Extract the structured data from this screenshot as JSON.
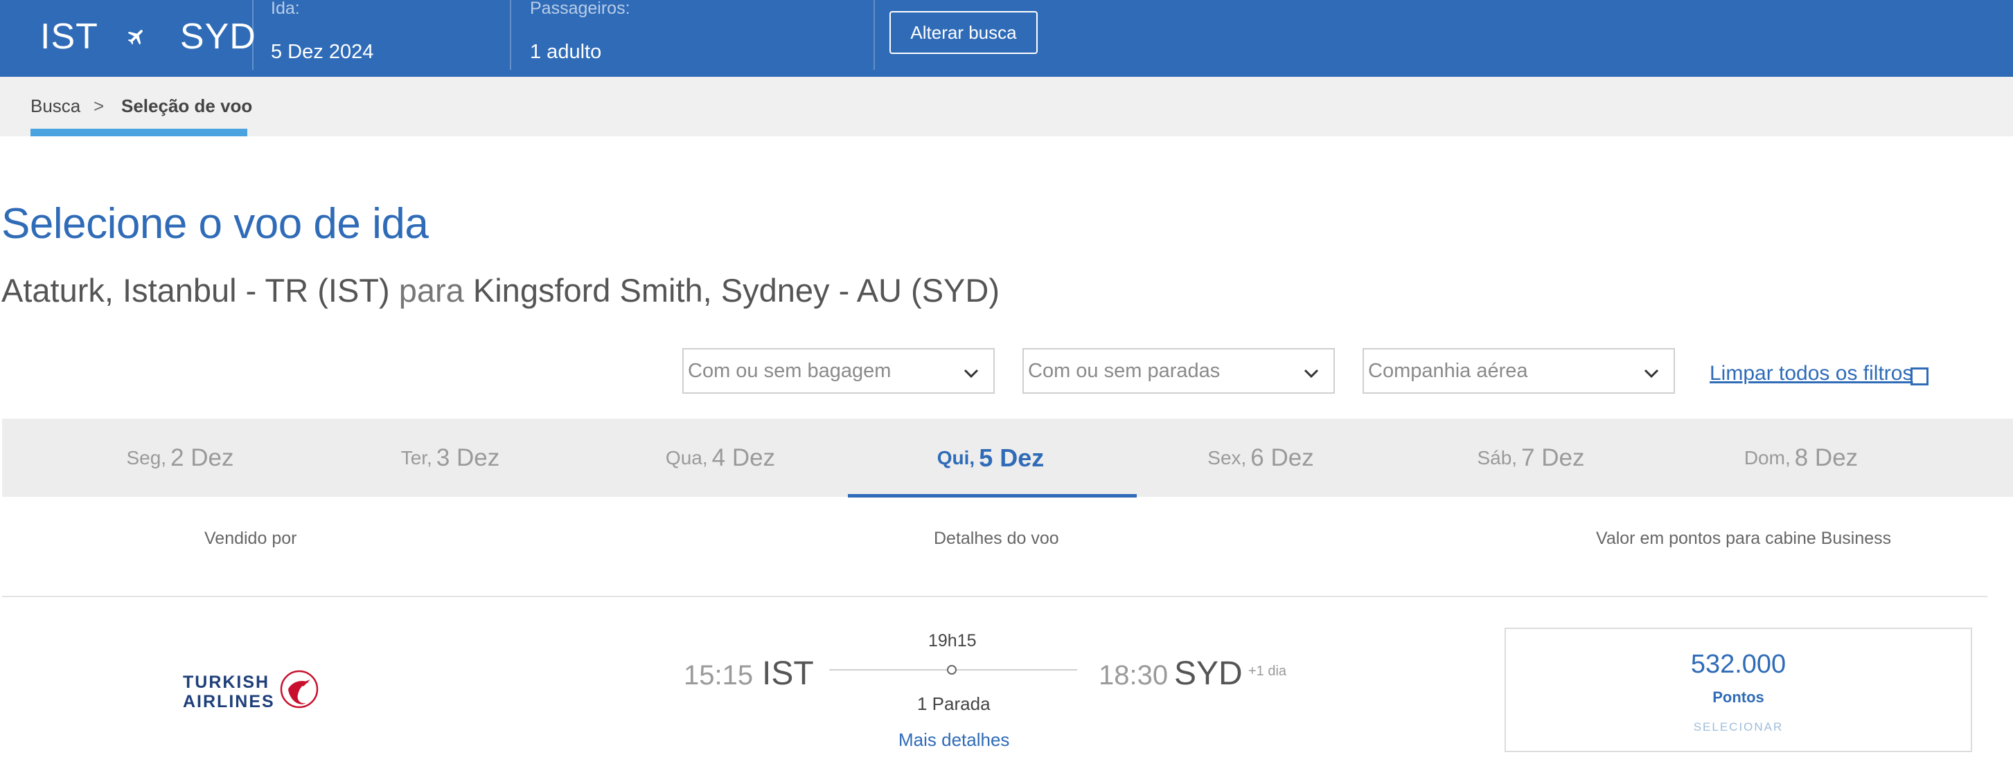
{
  "header": {
    "origin": "IST",
    "destination": "SYD",
    "plane_icon": "airplane-icon",
    "ida_label": "Ida:",
    "ida_value": "5 Dez 2024",
    "passengers_label": "Passageiros:",
    "passengers_value": "1 adulto",
    "change_search_label": "Alterar busca"
  },
  "breadcrumb": {
    "step1": "Busca",
    "separator": ">",
    "step2": "Seleção de voo"
  },
  "page": {
    "title": "Selecione o voo de ida",
    "subtitle_from": "Ataturk, Istanbul - TR (IST)",
    "subtitle_connector": "para",
    "subtitle_to": "Kingsford Smith, Sydney - AU (SYD)"
  },
  "filters": {
    "baggage_placeholder": "Com ou sem bagagem",
    "stops_placeholder": "Com ou sem paradas",
    "airline_placeholder": "Companhia aérea",
    "clear_label": "Limpar todos os filtros"
  },
  "date_tabs": [
    {
      "weekday": "Seg,",
      "date": "2 Dez",
      "active": false
    },
    {
      "weekday": "Ter,",
      "date": "3 Dez",
      "active": false
    },
    {
      "weekday": "Qua,",
      "date": "4 Dez",
      "active": false
    },
    {
      "weekday": "Qui,",
      "date": "5 Dez",
      "active": true
    },
    {
      "weekday": "Sex,",
      "date": "6 Dez",
      "active": false
    },
    {
      "weekday": "Sáb,",
      "date": "7 Dez",
      "active": false
    },
    {
      "weekday": "Dom,",
      "date": "8 Dez",
      "active": false
    }
  ],
  "columns": {
    "sold_by": "Vendido por",
    "flight_details": "Detalhes do voo",
    "points_value": "Valor em pontos para cabine Business"
  },
  "flight": {
    "airline_line1": "TURKISH",
    "airline_line2": "AIRLINES",
    "depart_time": "15:15",
    "depart_iata": "IST",
    "duration": "19h15",
    "arrive_time": "18:30",
    "arrive_iata": "SYD",
    "day_offset": "+1 dia",
    "stops": "1 Parada",
    "more_details": "Mais detalhes",
    "points": "532.000",
    "points_label": "Pontos",
    "select_label": "SELECIONAR"
  },
  "colors": {
    "brand_blue": "#2f6bb7",
    "breadcrumb_accent": "#4aa3df",
    "turkish_red": "#c8102e",
    "turkish_navy": "#1f3f7a"
  }
}
